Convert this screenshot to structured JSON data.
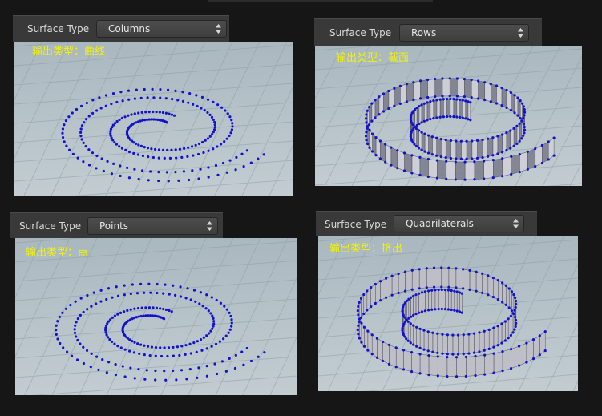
{
  "panels": [
    {
      "id": "tl",
      "param_label": "Surface Type",
      "selected_value": "Columns",
      "caption": "输出类型：曲线",
      "mode": "dots"
    },
    {
      "id": "tr",
      "param_label": "Surface Type",
      "selected_value": "Rows",
      "caption": "输出类型：截面",
      "mode": "sections"
    },
    {
      "id": "bl",
      "param_label": "Surface Type",
      "selected_value": "Points",
      "caption": "输出类型：点",
      "mode": "dots"
    },
    {
      "id": "br",
      "param_label": "Surface Type",
      "selected_value": "Quadrilaterals",
      "caption": "输出类型：挤出",
      "mode": "extrude"
    }
  ],
  "colors": {
    "point_color": "#1212cc",
    "caption_color": "#f3f300",
    "surface_color": "#bfbfc7",
    "grid_color": "#8fa0a8"
  },
  "icons": {
    "dropdown": "updown-arrows-icon"
  }
}
